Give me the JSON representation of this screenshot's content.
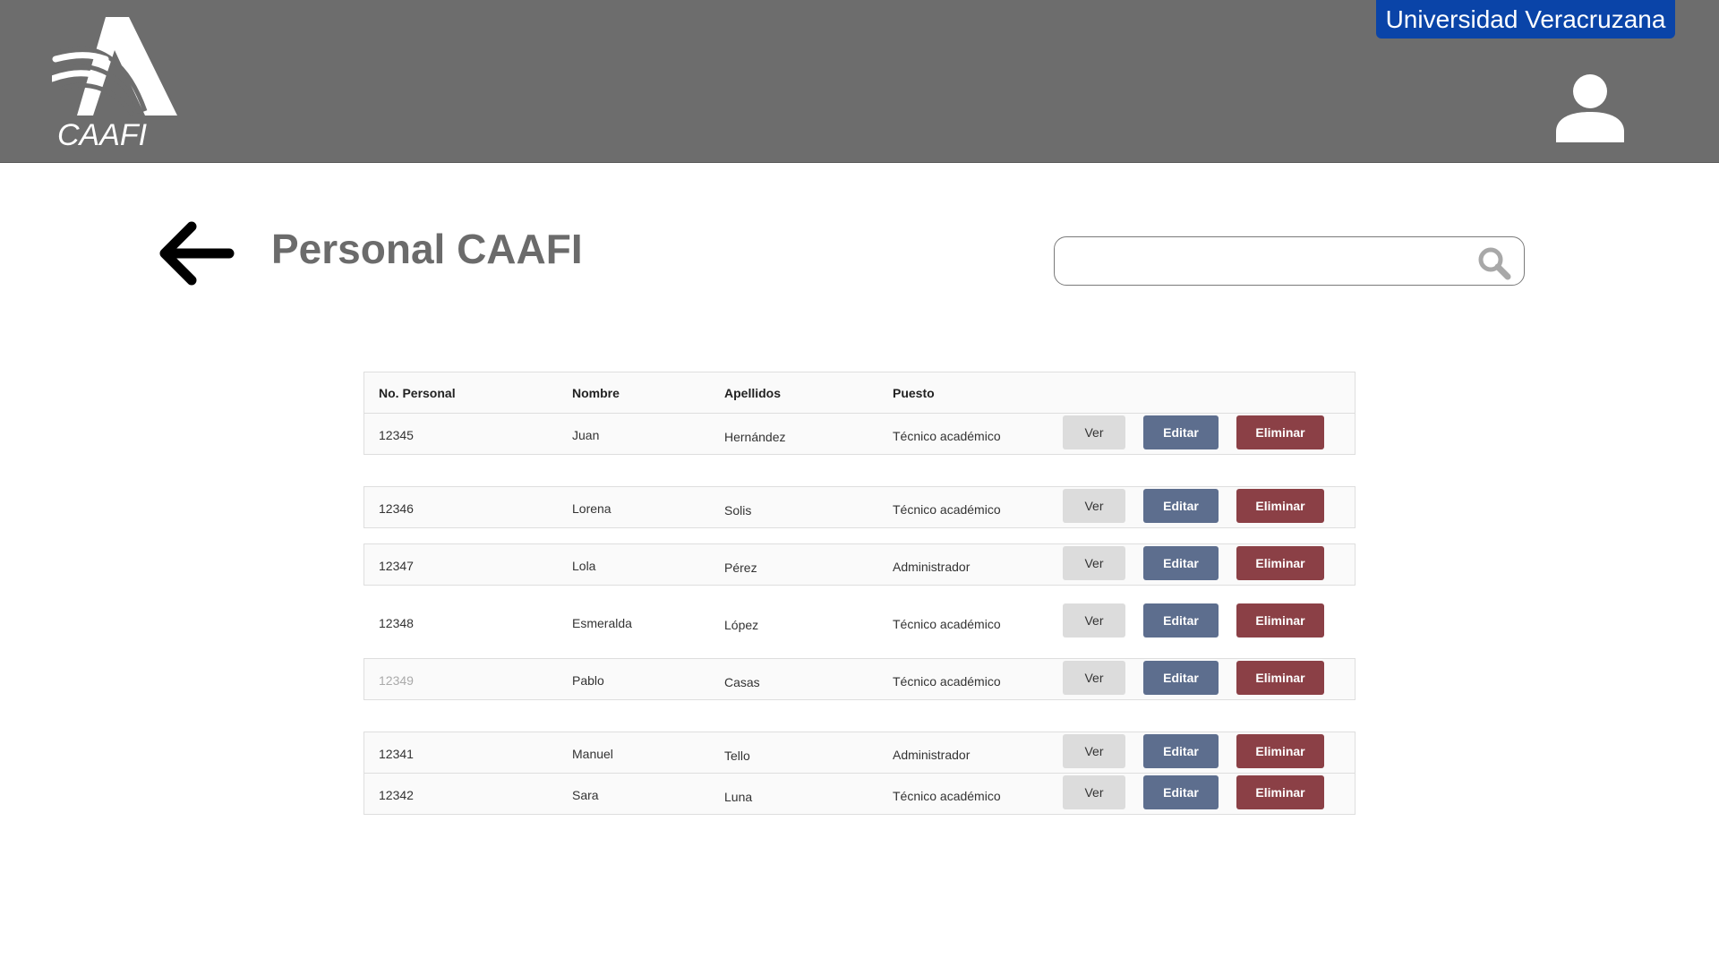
{
  "header": {
    "logo_text": "CAAFI",
    "university": "Universidad Veracruzana",
    "logo_icon": "caafi-logo",
    "user_icon": "user-icon"
  },
  "page": {
    "title": "Personal CAAFI",
    "back_icon": "arrow-left-icon"
  },
  "search": {
    "value": "",
    "placeholder": "",
    "icon": "search-icon"
  },
  "table": {
    "columns": [
      "No. Personal",
      "Nombre",
      "Apellidos",
      "Puesto"
    ],
    "actions": {
      "view": "Ver",
      "edit": "Editar",
      "delete": "Eliminar"
    },
    "rows": [
      {
        "no": "12345",
        "nombre": "Juan",
        "apellidos": "Hernández",
        "puesto": "Técnico académico"
      },
      {
        "no": "12346",
        "nombre": "Lorena",
        "apellidos": "Solis",
        "puesto": "Técnico académico"
      },
      {
        "no": "12347",
        "nombre": "Lola",
        "apellidos": "Pérez",
        "puesto": "Administrador"
      },
      {
        "no": "12348",
        "nombre": "Esmeralda",
        "apellidos": "López",
        "puesto": "Técnico académico"
      },
      {
        "no": "12349",
        "nombre": "Pablo",
        "apellidos": "Casas",
        "puesto": "Técnico académico"
      },
      {
        "no": "12341",
        "nombre": "Manuel",
        "apellidos": "Tello",
        "puesto": "Administrador"
      },
      {
        "no": "12342",
        "nombre": "Sara",
        "apellidos": "Luna",
        "puesto": "Técnico académico"
      }
    ]
  },
  "colors": {
    "header_bg": "#6d6d6d",
    "university_badge": "#0a44a8",
    "view_button": "#dcdcdc",
    "edit_button": "#5d6e8e",
    "delete_button": "#8b4046"
  }
}
